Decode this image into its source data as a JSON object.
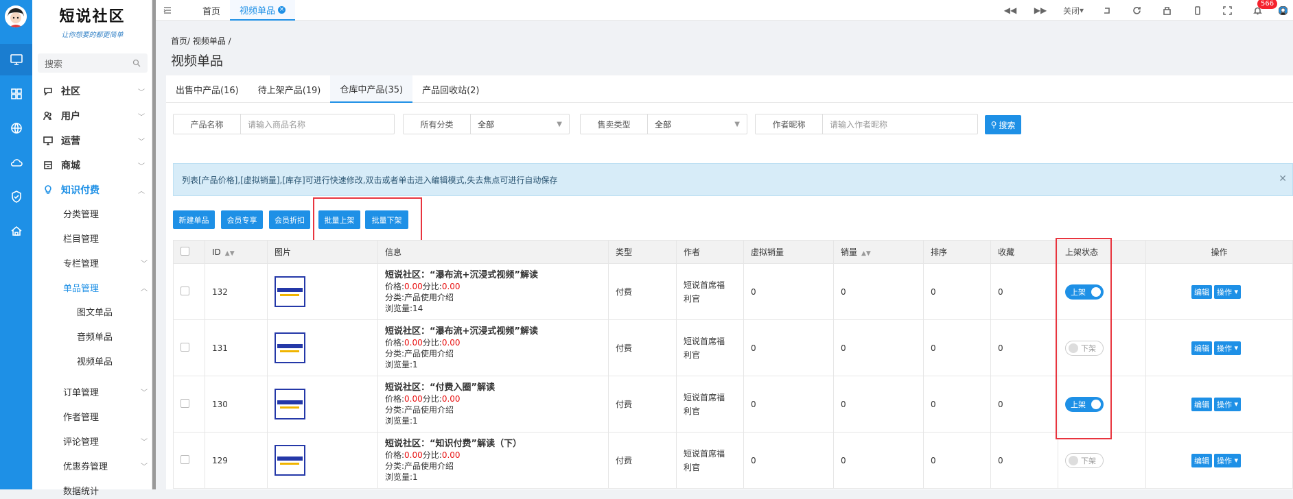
{
  "brand": {
    "title": "短说社区",
    "slogan": "让你想要的都更简单"
  },
  "sidebar": {
    "search_label": "搜索",
    "menu": [
      {
        "label": "社区"
      },
      {
        "label": "用户"
      },
      {
        "label": "运营"
      },
      {
        "label": "商城"
      },
      {
        "label": "知识付费"
      }
    ],
    "knowledge_sub": [
      "分类管理",
      "栏目管理",
      "专栏管理",
      "单品管理"
    ],
    "single_sub": [
      "图文单品",
      "音频单品",
      "视频单品"
    ],
    "more_sub": [
      "订单管理",
      "作者管理",
      "评论管理",
      "优惠券管理",
      "数据统计"
    ]
  },
  "topbar": {
    "tabs": [
      {
        "label": "首页"
      },
      {
        "label": "视频单品"
      }
    ],
    "close_label": "关闭",
    "badge_count": "566"
  },
  "breadcrumb": "首页/ 视频单品 /",
  "page_title": "视频单品",
  "product_tabs": [
    {
      "label": "出售中产品(16)"
    },
    {
      "label": "待上架产品(19)"
    },
    {
      "label": "仓库中产品(35)"
    },
    {
      "label": "产品回收站(2)"
    }
  ],
  "filters": {
    "name_label": "产品名称",
    "name_placeholder": "请输入商品名称",
    "category_label": "所有分类",
    "category_value": "全部",
    "sale_label": "售卖类型",
    "sale_value": "全部",
    "author_label": "作者昵称",
    "author_placeholder": "请输入作者昵称",
    "search_button": "搜索"
  },
  "tip": "列表[产品价格],[虚拟销量],[库存]可进行快速修改,双击或者单击进入编辑模式,失去焦点可进行自动保存",
  "actions": [
    "新建单品",
    "会员专享",
    "会员折扣",
    "批量上架",
    "批量下架"
  ],
  "table": {
    "headers": [
      "ID",
      "图片",
      "信息",
      "类型",
      "作者",
      "虚拟销量",
      "销量",
      "排序",
      "收藏",
      "上架状态",
      "操作"
    ],
    "rows": [
      {
        "id": "132",
        "name": "短说社区：“瀑布流+沉浸式视频”解读",
        "price_label": "价格:",
        "price": "0.00",
        "split_label": "分比:",
        "split": "0.00",
        "category": "分类:产品使用介绍",
        "views": "浏览量:14",
        "type": "付费",
        "author": "短说首席福利官",
        "virtual_sales": "0",
        "sales": "0",
        "sort": "0",
        "fav": "0",
        "status": "上架",
        "on": true
      },
      {
        "id": "131",
        "name": "短说社区：“瀑布流+沉浸式视频”解读",
        "price_label": "价格:",
        "price": "0.00",
        "split_label": "分比:",
        "split": "0.00",
        "category": "分类:产品使用介绍",
        "views": "浏览量:1",
        "type": "付费",
        "author": "短说首席福利官",
        "virtual_sales": "0",
        "sales": "0",
        "sort": "0",
        "fav": "0",
        "status": "下架",
        "on": false
      },
      {
        "id": "130",
        "name": "短说社区：“付费入圈”解读",
        "price_label": "价格:",
        "price": "0.00",
        "split_label": "分比:",
        "split": "0.00",
        "category": "分类:产品使用介绍",
        "views": "浏览量:1",
        "type": "付费",
        "author": "短说首席福利官",
        "virtual_sales": "0",
        "sales": "0",
        "sort": "0",
        "fav": "0",
        "status": "上架",
        "on": true
      },
      {
        "id": "129",
        "name": "短说社区：“知识付费”解读（下）",
        "price_label": "价格:",
        "price": "0.00",
        "split_label": "分比:",
        "split": "0.00",
        "category": "分类:产品使用介绍",
        "views": "浏览量:1",
        "type": "付费",
        "author": "短说首席福利官",
        "virtual_sales": "0",
        "sales": "0",
        "sort": "0",
        "fav": "0",
        "status": "下架",
        "on": false
      }
    ],
    "edit_label": "编辑",
    "op_label": "操作"
  },
  "colors": {
    "accent": "#1E90E6",
    "highlight": "#e8343e"
  }
}
